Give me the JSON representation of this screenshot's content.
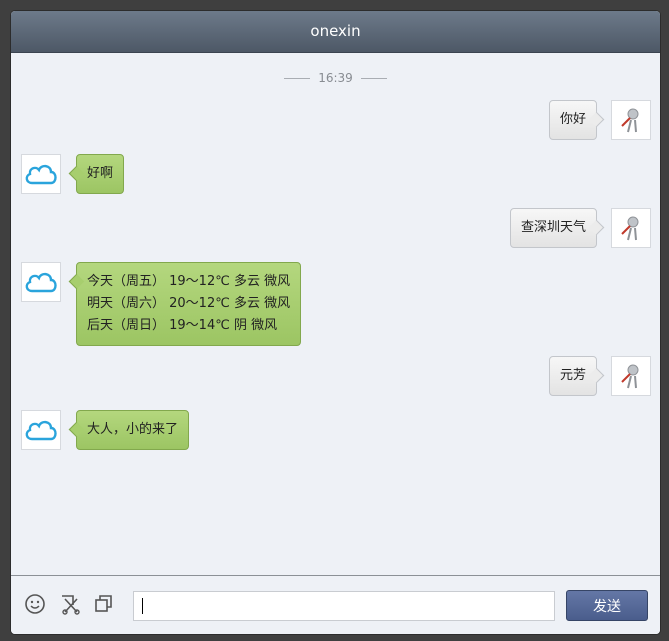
{
  "window": {
    "title": "onexin"
  },
  "chat": {
    "timestamp": "16:39",
    "messages": [
      {
        "sender": "user",
        "avatar_icon": "user-avatar-icon",
        "lines": [
          "你好"
        ]
      },
      {
        "sender": "bot",
        "avatar_icon": "cloud-avatar-icon",
        "lines": [
          "好啊"
        ]
      },
      {
        "sender": "user",
        "avatar_icon": "user-avatar-icon",
        "lines": [
          "查深圳天气"
        ]
      },
      {
        "sender": "bot",
        "avatar_icon": "cloud-avatar-icon",
        "lines": [
          "今天（周五） 19～12℃ 多云 微风",
          "明天（周六） 20～12℃ 多云 微风",
          "后天（周日） 19～14℃ 阴 微风"
        ]
      },
      {
        "sender": "user",
        "avatar_icon": "user-avatar-icon",
        "lines": [
          "元芳"
        ]
      },
      {
        "sender": "bot",
        "avatar_icon": "cloud-avatar-icon",
        "lines": [
          "大人，小的来了"
        ]
      }
    ]
  },
  "footer": {
    "tools": [
      "emoji-icon",
      "screenshot-cut-icon",
      "window-copy-icon"
    ],
    "input_value": "",
    "send_label": "发送"
  },
  "colors": {
    "titlebar": "#5b6675",
    "bot_bubble": "#a7ce6e",
    "user_bubble": "#ececec",
    "send_button": "#56699a",
    "background": "#eef1f6"
  }
}
